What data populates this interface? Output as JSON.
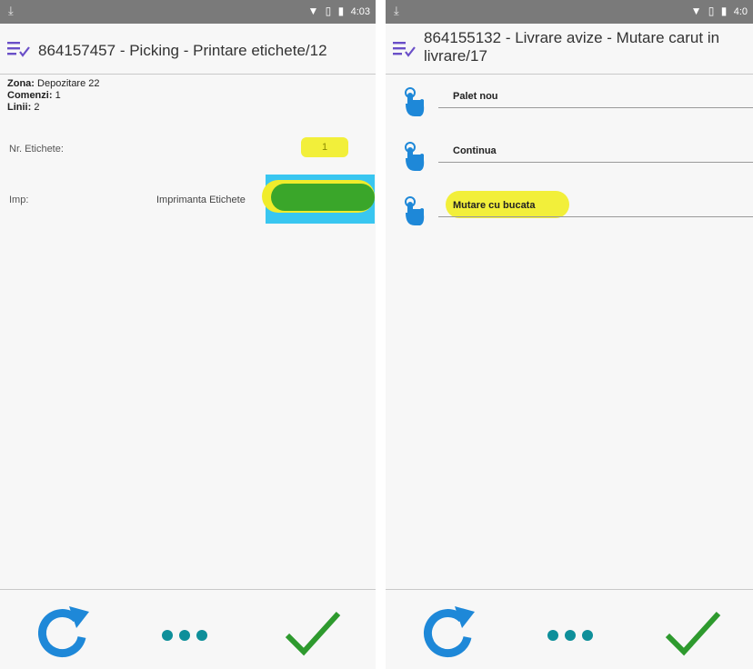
{
  "left": {
    "status_time": "4:03",
    "title": "864157457 - Picking - Printare etichete/12",
    "info": {
      "zona_label": "Zona:",
      "zona_value": "Depozitare 22",
      "comenzi_label": "Comenzi:",
      "comenzi_value": "1",
      "linii_label": "Linii:",
      "linii_value": "2"
    },
    "fields": {
      "etichete_label": "Nr. Etichete:",
      "etichete_value": "1",
      "imp_label": "Imp:",
      "imp_value": "Imprimanta Etichete"
    }
  },
  "right": {
    "status_time": "4:0",
    "title": "864155132 - Livrare avize - Mutare carut in livrare/17",
    "actions": [
      {
        "label": "Palet nou"
      },
      {
        "label": "Continua"
      },
      {
        "label": "Mutare cu bucata"
      }
    ]
  },
  "colors": {
    "accent_blue": "#1e88d8",
    "check_green": "#2e9a2e",
    "dots_teal": "#0e8f9a",
    "menu_purple": "#6a4fc8",
    "highlight_yellow": "#f2ef3a"
  }
}
